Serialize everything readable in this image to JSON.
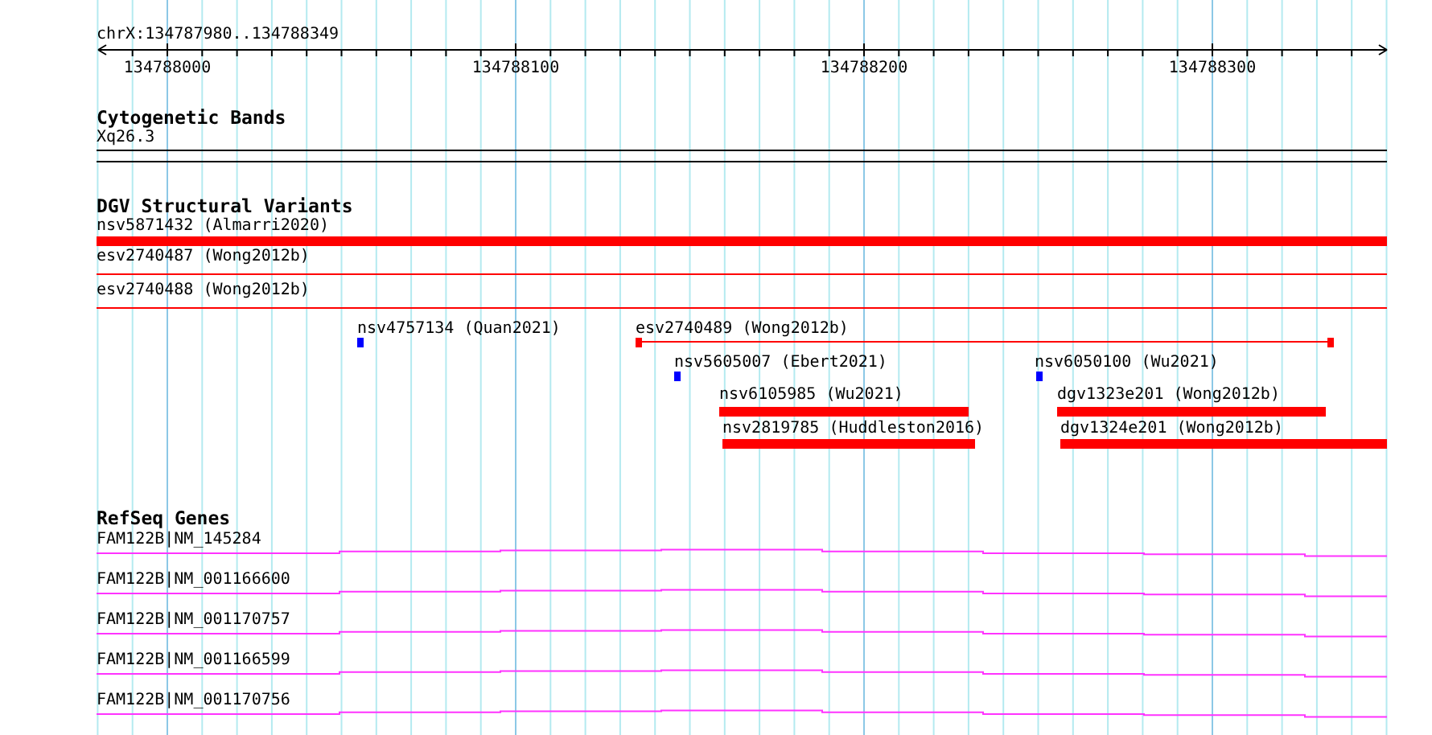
{
  "ruler": {
    "location": "chrX:134787980..134788349",
    "tick_labels": [
      "134788000",
      "134788100",
      "134788200",
      "134788300"
    ]
  },
  "tracks": [
    {
      "title": "Cytogenetic Bands",
      "kind": "bands",
      "features": [
        {
          "label": "Xq26.3"
        }
      ]
    },
    {
      "title": "DGV Structural Variants",
      "kind": "variants",
      "features": [
        {
          "label": "nsv5871432 (Almarri2020)",
          "kind": "bar",
          "color": "#ff0000"
        },
        {
          "label": "esv2740487 (Wong2012b)",
          "kind": "line",
          "color": "#ff0000"
        },
        {
          "label": "esv2740488 (Wong2012b)",
          "kind": "line",
          "color": "#ff0000"
        },
        {
          "label": "nsv4757134 (Quan2021)",
          "kind": "point",
          "color": "#0000ff"
        },
        {
          "label": "esv2740489 (Wong2012b)",
          "kind": "span",
          "color": "#ff0000"
        },
        {
          "label": "nsv5605007 (Ebert2021)",
          "kind": "point",
          "color": "#0000ff"
        },
        {
          "label": "nsv6050100 (Wu2021)",
          "kind": "point",
          "color": "#0000ff"
        },
        {
          "label": "nsv6105985 (Wu2021)",
          "kind": "bar",
          "color": "#ff0000"
        },
        {
          "label": "dgv1323e201 (Wong2012b)",
          "kind": "bar",
          "color": "#ff0000"
        },
        {
          "label": "nsv2819785 (Huddleston2016)",
          "kind": "bar",
          "color": "#ff0000"
        },
        {
          "label": "dgv1324e201 (Wong2012b)",
          "kind": "bar",
          "color": "#ff0000"
        }
      ]
    },
    {
      "title": "RefSeq Genes",
      "kind": "genes",
      "features": [
        {
          "label": "FAM122B|NM_145284"
        },
        {
          "label": "FAM122B|NM_001166600"
        },
        {
          "label": "FAM122B|NM_001170757"
        },
        {
          "label": "FAM122B|NM_001166599"
        },
        {
          "label": "FAM122B|NM_001170756"
        }
      ]
    }
  ]
}
